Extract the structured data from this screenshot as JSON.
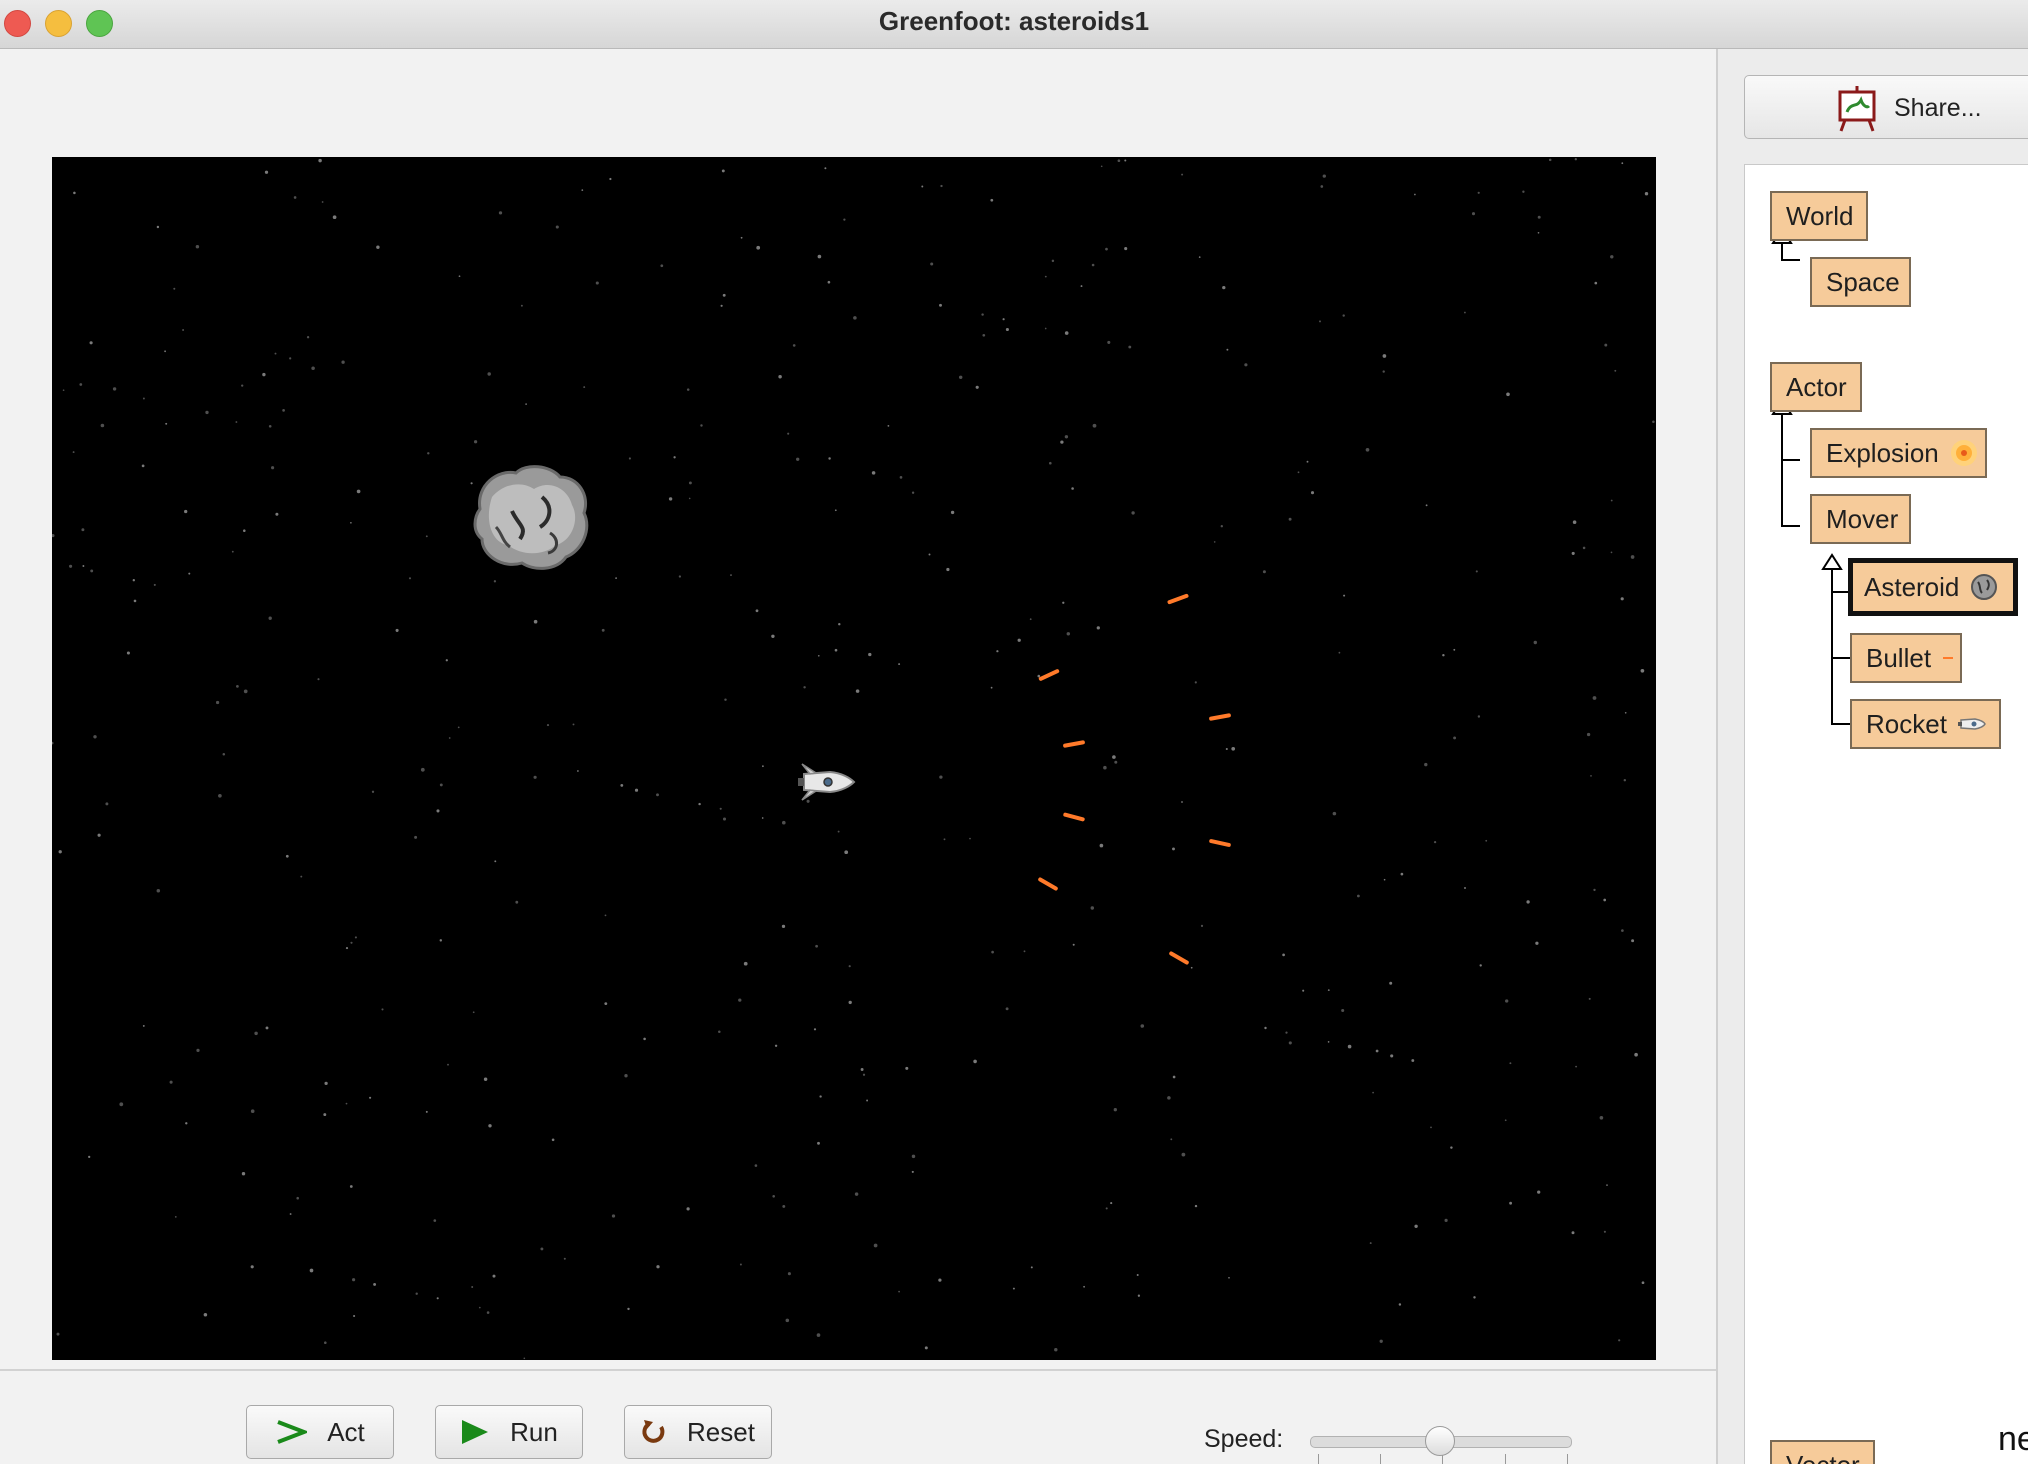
{
  "window": {
    "title": "Greenfoot: asteroids1"
  },
  "controls": {
    "act_label": "Act",
    "run_label": "Run",
    "reset_label": "Reset",
    "speed_label": "Speed:",
    "speed_value": 0.5
  },
  "sidebar": {
    "share_label": "Share...",
    "world_classes": [
      "World",
      "Space"
    ],
    "actor_classes": [
      "Actor",
      "Explosion",
      "Mover",
      "Asteroid",
      "Bullet",
      "Rocket"
    ],
    "other_classes": [
      "Vector"
    ],
    "selected_class": "Asteroid",
    "cut_off_text": "ne"
  },
  "world": {
    "background": "#000000",
    "bullet_color": "#ff7a2a",
    "actors": [
      "asteroid",
      "rocket",
      "bullets"
    ]
  }
}
